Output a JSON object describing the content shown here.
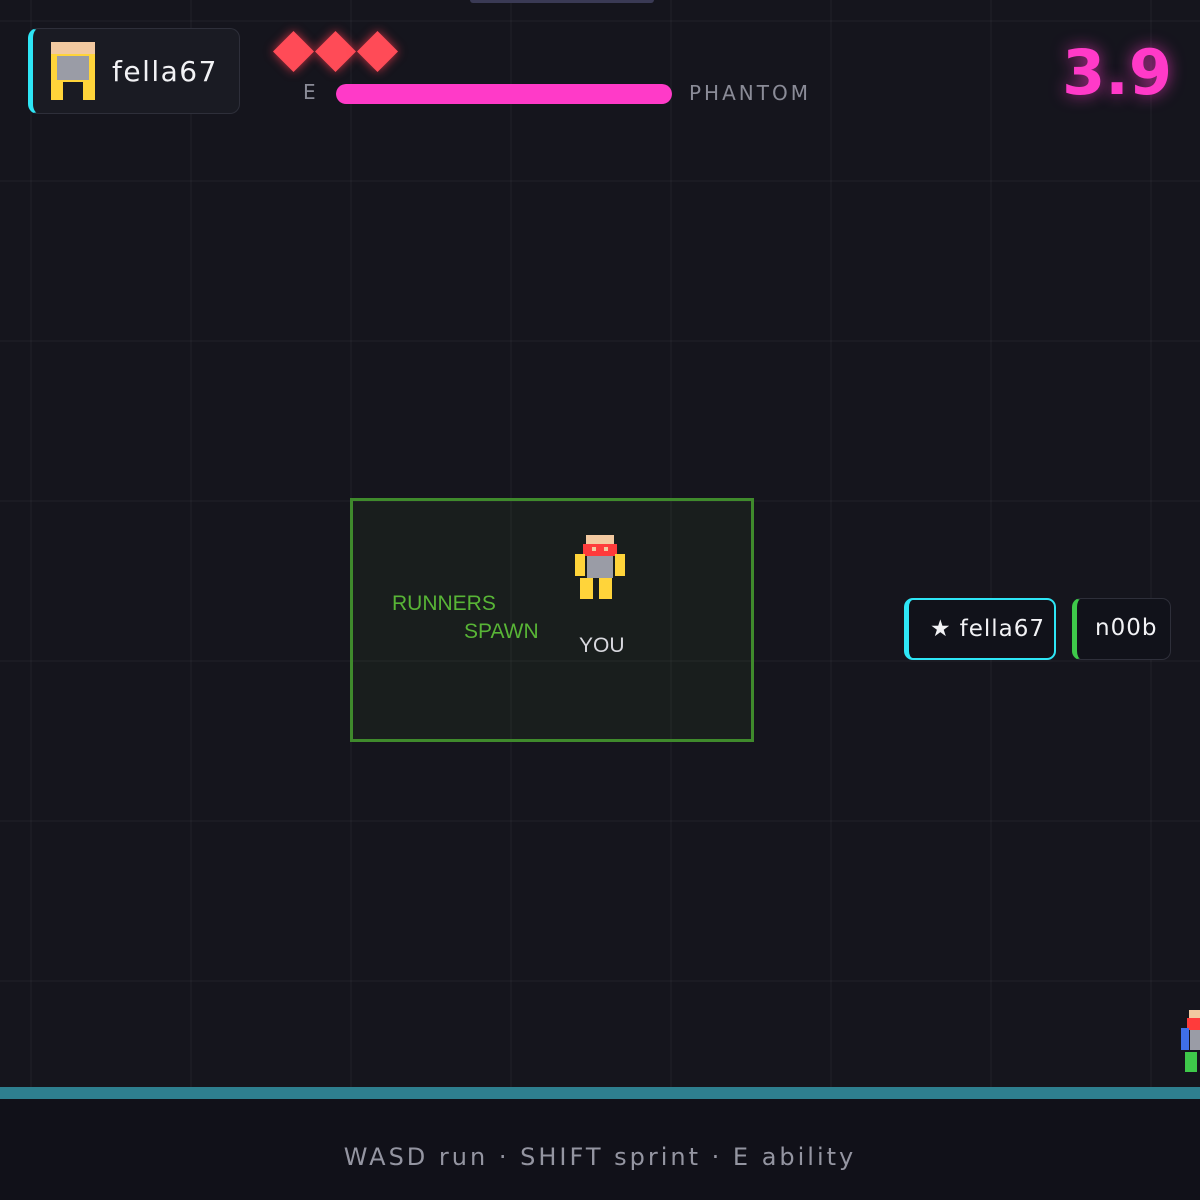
{
  "hud": {
    "player_name": "fella67",
    "lives": 3,
    "ability_key": "E",
    "ability_name": "PHANTOM",
    "ability_charge": 1.0,
    "timer": "3.9",
    "colors": {
      "accent_cyan": "#2ee6f6",
      "timer_pink": "#ff3ac8",
      "life_red": "#ff4b57",
      "spawn_green": "#58b536",
      "floor_teal": "#2e7f8f"
    }
  },
  "spawn_zone": {
    "label_line1": "RUNNERS",
    "label_line2": "SPAWN",
    "player_tag": "YOU"
  },
  "roster": [
    {
      "icon": "★",
      "name": "fella67",
      "is_self": true
    },
    {
      "name": "n00b",
      "is_self": false
    }
  ],
  "controls_hint": "WASD run · SHIFT sprint · E ability"
}
